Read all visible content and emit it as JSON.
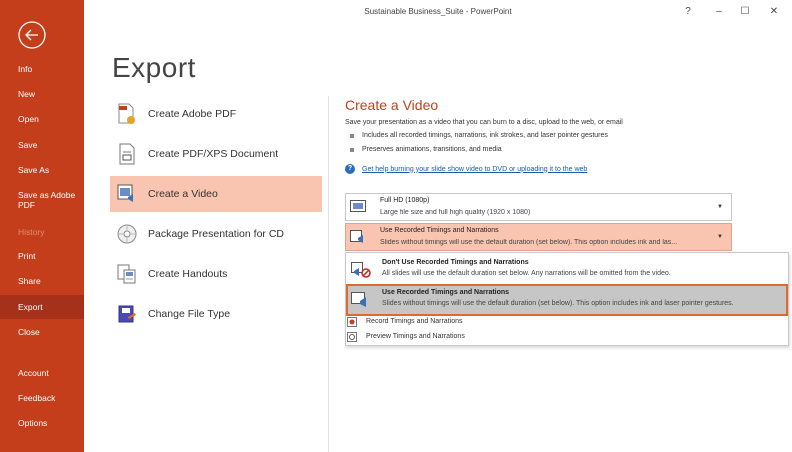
{
  "window": {
    "title": "Sustainable Business_Suite - PowerPoint",
    "help": "?",
    "minimize": "–",
    "maximize": "☐",
    "close": "✕"
  },
  "sidebar": {
    "items": [
      {
        "label": "Info"
      },
      {
        "label": "New"
      },
      {
        "label": "Open"
      },
      {
        "label": "Save"
      },
      {
        "label": "Save As"
      },
      {
        "label": "Save as Adobe PDF"
      },
      {
        "label": "History"
      },
      {
        "label": "Print"
      },
      {
        "label": "Share"
      },
      {
        "label": "Export"
      },
      {
        "label": "Close"
      },
      {
        "label": "Account"
      },
      {
        "label": "Feedback"
      },
      {
        "label": "Options"
      }
    ]
  },
  "main": {
    "heading": "Export",
    "options": [
      {
        "label": "Create Adobe PDF",
        "icon": "adobe-pdf-icon"
      },
      {
        "label": "Create PDF/XPS Document",
        "icon": "pdf-xps-icon"
      },
      {
        "label": "Create a Video",
        "icon": "video-icon"
      },
      {
        "label": "Package Presentation for CD",
        "icon": "cd-icon"
      },
      {
        "label": "Create Handouts",
        "icon": "handouts-icon"
      },
      {
        "label": "Change File Type",
        "icon": "file-type-icon"
      }
    ]
  },
  "panel": {
    "title": "Create a Video",
    "description": "Save your presentation as a video that you can burn to a disc, upload to the web, or email",
    "bullets": [
      "Includes all recorded timings, narrations, ink strokes, and laser pointer gestures",
      "Preserves animations, transitions, and media"
    ],
    "help_link": "Get help burning your slide show video to DVD or uploading it to the web",
    "quality": {
      "title": "Full HD (1080p)",
      "subtitle": "Large file size and full high quality (1920 x 1080)"
    },
    "timings": {
      "title": "Use Recorded Timings and Narrations",
      "subtitle": "Slides without timings will use the default duration (set below). This option includes ink and las..."
    },
    "menu": [
      {
        "title": "Don't Use Recorded Timings and Narrations",
        "subtitle": "All slides will use the default duration set below. Any narrations will be omitted from the video."
      },
      {
        "title": "Use Recorded Timings and Narrations",
        "subtitle": "Slides without timings will use the default duration (set below). This option includes ink and laser pointer gestures."
      }
    ],
    "actions": [
      {
        "label": "Record Timings and Narrations"
      },
      {
        "label": "Preview Timings and Narrations"
      }
    ]
  },
  "colors": {
    "accent": "#c43e1c",
    "selected": "#f9c4b0",
    "highlight_border": "#e06a2c"
  }
}
